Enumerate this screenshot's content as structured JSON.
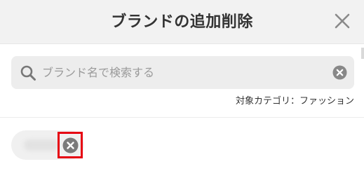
{
  "modal": {
    "title": "ブランドの追加削除",
    "close_icon": "close-icon"
  },
  "search": {
    "placeholder": "ブランド名で検索する",
    "value": "",
    "icon": "search-icon",
    "clear_icon": "clear-circle-icon"
  },
  "category_text": "対象カテゴリ：ファッション",
  "selected_brands": [
    {
      "name": "",
      "remove_icon": "remove-circle-icon"
    }
  ],
  "colors": {
    "header_bg": "#f2f2f2",
    "search_bg": "#ededed",
    "icon_gray": "#8a8a8a",
    "highlight": "#e60012"
  }
}
